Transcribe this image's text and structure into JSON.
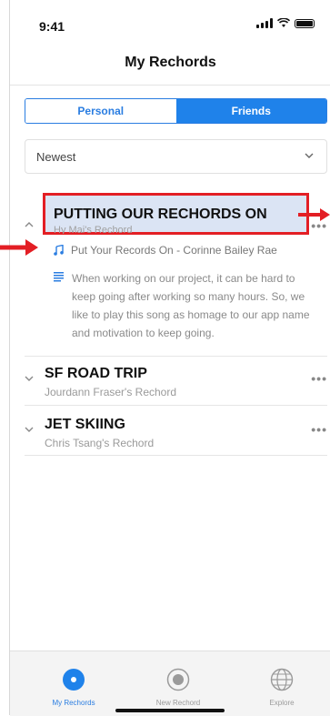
{
  "status": {
    "time": "9:41"
  },
  "header": {
    "title": "My Rechords"
  },
  "segment": {
    "left": "Personal",
    "right": "Friends",
    "selected": "Friends"
  },
  "sort": {
    "value": "Newest"
  },
  "entries": [
    {
      "title": "PUTTING OUR RECHORDS ON",
      "subtitle": "Hy Mai's Rechord",
      "song": "Put Your Records On - Corinne Bailey Rae",
      "description": "When working on our project, it can be hard to keep going after working so many hours. So, we like to play this song as homage to our app name and motivation to keep going.",
      "expanded": true
    },
    {
      "title": "SF ROAD TRIP",
      "subtitle": "Jourdann Fraser's Rechord",
      "expanded": false
    },
    {
      "title": "JET SKIING",
      "subtitle": "Chris Tsang's Rechord",
      "expanded": false
    }
  ],
  "tabs": [
    {
      "label": "My Rechords",
      "icon": "record-filled-icon",
      "active": true
    },
    {
      "label": "New Rechord",
      "icon": "record-outline-icon",
      "active": false
    },
    {
      "label": "Explore",
      "icon": "globe-icon",
      "active": false
    }
  ],
  "colors": {
    "accent": "#1f82ea",
    "annotation": "#e31e24"
  }
}
